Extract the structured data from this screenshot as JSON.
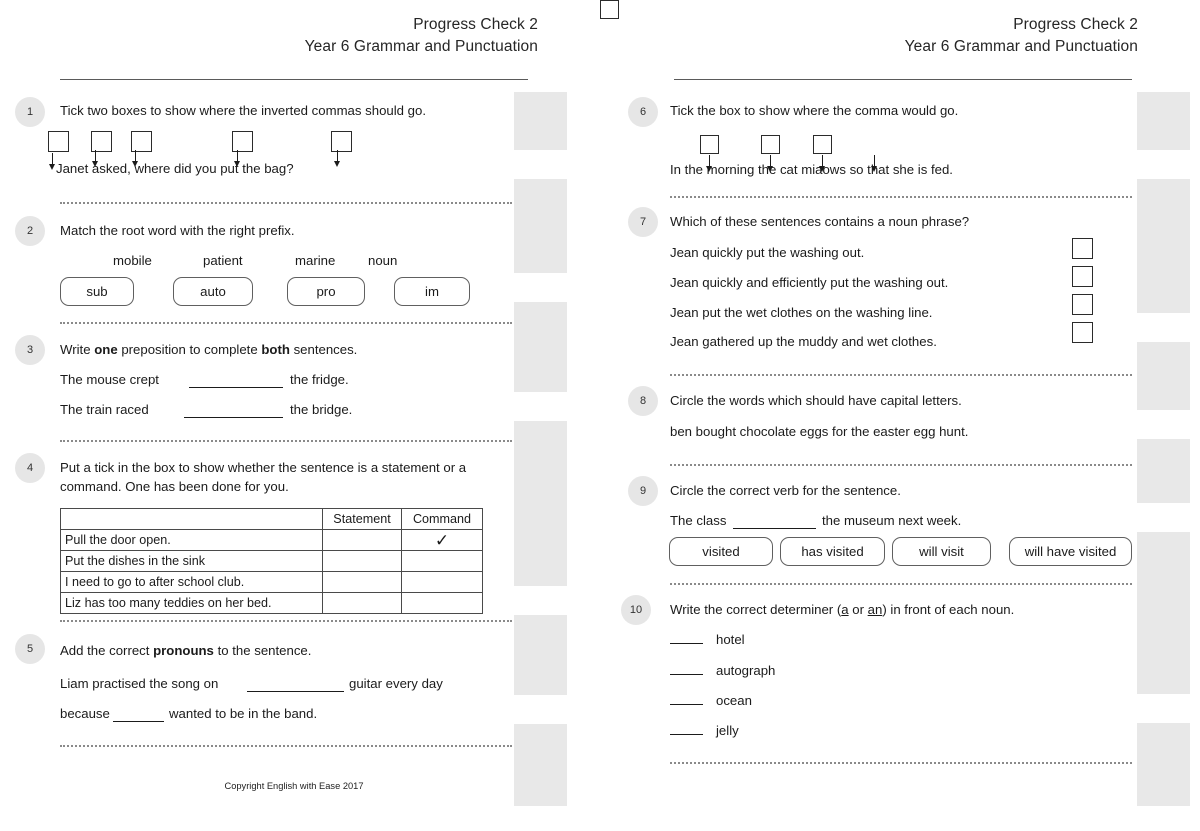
{
  "header": {
    "title": "Progress Check 2",
    "subtitle": "Year 6 Grammar and Punctuation"
  },
  "footer": {
    "copyright": "Copyright English with Ease 2017"
  },
  "colors": {
    "mark_column_bg": "#e8e8e8",
    "mark_box_bg": "#ffffff",
    "question_number_bg": "#e6e6e6",
    "text": "#1b1b1b",
    "rule": "#5a5a5a",
    "dotted_divider": "#8a8a8a"
  },
  "left_page": {
    "questions": [
      {
        "number": "1",
        "prompt": "Tick two boxes to show where the inverted commas should go.",
        "sentence": "Janet asked, where did you put the bag?",
        "tick_box_count": 5
      },
      {
        "number": "2",
        "prompt": "Match the root word with the right prefix.",
        "root_words": [
          "mobile",
          "patient",
          "marine",
          "noun"
        ],
        "prefixes": [
          "sub",
          "auto",
          "pro",
          "im"
        ]
      },
      {
        "number": "3",
        "prompt_parts": [
          "Write ",
          "one",
          " preposition to complete ",
          "both",
          " sentences."
        ],
        "prompt": "Write one preposition to complete both sentences.",
        "sentences": [
          {
            "before": "The mouse crept",
            "after": "the fridge."
          },
          {
            "before": "The train raced",
            "after": "the bridge."
          }
        ]
      },
      {
        "number": "4",
        "prompt": "Put a tick in the box to show whether the sentence is a statement or a command. One has been done for you.",
        "table": {
          "headers": [
            "",
            "Statement",
            "Command"
          ],
          "rows": [
            {
              "sentence": "Pull the door open.",
              "statement": "",
              "command": "✓"
            },
            {
              "sentence": "Put the dishes in the sink",
              "statement": "",
              "command": ""
            },
            {
              "sentence": "I need to go to after school club.",
              "statement": "",
              "command": ""
            },
            {
              "sentence": "Liz has too many teddies on her bed.",
              "statement": "",
              "command": ""
            }
          ]
        }
      },
      {
        "number": "5",
        "prompt_parts": [
          "Add the correct ",
          "pronouns",
          " to the sentence."
        ],
        "prompt": "Add the correct pronouns to the sentence.",
        "line1_before": "Liam practised the song on",
        "line1_after": "guitar every day",
        "line2_before": "because",
        "line2_after": "wanted to be in the band."
      }
    ],
    "mark_boxes": 5
  },
  "right_page": {
    "questions": [
      {
        "number": "6",
        "prompt": "Tick the box to show where the comma would go.",
        "sentence": "In the morning the cat miaows so that she is fed.",
        "tick_box_count": 4
      },
      {
        "number": "7",
        "prompt": "Which of these sentences contains a noun phrase?",
        "options": [
          "Jean quickly put the washing out.",
          "Jean quickly and efficiently put the washing out.",
          "Jean put the wet clothes on the washing line.",
          "Jean gathered up the muddy and wet clothes."
        ]
      },
      {
        "number": "8",
        "prompt": "Circle the words which should have capital letters.",
        "sentence": "ben bought chocolate eggs for the easter egg hunt."
      },
      {
        "number": "9",
        "prompt": "Circle the correct verb for the sentence.",
        "sentence_before": "The class",
        "sentence_after": "the museum next week.",
        "choices": [
          "visited",
          "has visited",
          "will visit",
          "will have visited"
        ]
      },
      {
        "number": "10",
        "prompt_parts": [
          "Write the correct determiner (",
          "a",
          " or ",
          "an",
          ") in front of each noun."
        ],
        "prompt": "Write the correct determiner (a or an) in front of each noun.",
        "nouns": [
          "hotel",
          "autograph",
          "ocean",
          "jelly"
        ]
      }
    ],
    "mark_boxes": 5
  }
}
